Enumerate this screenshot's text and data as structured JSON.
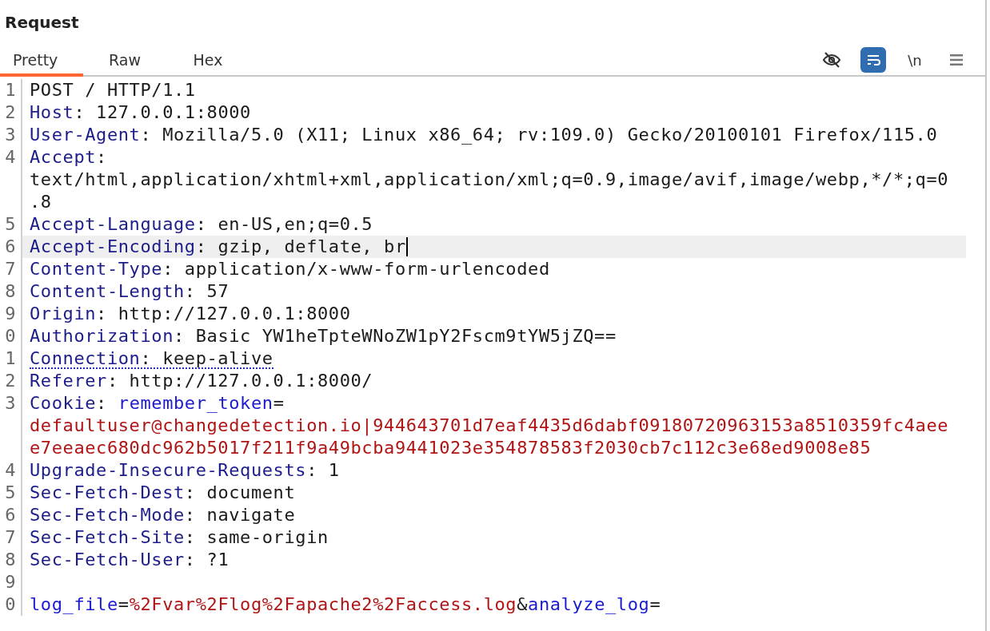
{
  "title": "Request",
  "tabs": [
    {
      "label": "Pretty",
      "selected": true
    },
    {
      "label": "Raw",
      "selected": false
    },
    {
      "label": "Hex",
      "selected": false
    }
  ],
  "toolbar": [
    {
      "kind": "hide",
      "selected": false
    },
    {
      "kind": "wrap",
      "selected": true
    },
    {
      "kind": "text",
      "label": "\\n",
      "selected": false
    },
    {
      "kind": "menu",
      "selected": false
    }
  ],
  "lines": [
    {
      "number": "1",
      "highlighted": false,
      "underlined": false,
      "rows": [
        [
          {
            "kind": "plain",
            "text": "POST / HTTP/1.1"
          }
        ]
      ]
    },
    {
      "number": "2",
      "highlighted": false,
      "underlined": false,
      "rows": [
        [
          {
            "kind": "name",
            "text": "Host"
          },
          {
            "kind": "plain",
            "text": ": 127.0.0.1:8000"
          }
        ]
      ]
    },
    {
      "number": "3",
      "highlighted": false,
      "underlined": false,
      "rows": [
        [
          {
            "kind": "name",
            "text": "User-Agent"
          },
          {
            "kind": "plain",
            "text": ": Mozilla/5.0 (X11; Linux x86_64; rv:109.0) Gecko/20100101 Firefox/115.0"
          }
        ]
      ]
    },
    {
      "number": "4",
      "highlighted": false,
      "underlined": false,
      "rows": [
        [
          {
            "kind": "name",
            "text": "Accept"
          },
          {
            "kind": "plain",
            "text": ":"
          }
        ],
        [
          {
            "kind": "plain",
            "text": "text/html,application/xhtml+xml,application/xml;q=0.9,image/avif,image/webp,*/*;q=0"
          }
        ],
        [
          {
            "kind": "plain",
            "text": ".8"
          }
        ]
      ]
    },
    {
      "number": "5",
      "highlighted": false,
      "underlined": false,
      "rows": [
        [
          {
            "kind": "name",
            "text": "Accept-Language"
          },
          {
            "kind": "plain",
            "text": ": en-US,en;q=0.5"
          }
        ]
      ]
    },
    {
      "number": "6",
      "highlighted": true,
      "underlined": false,
      "rows": [
        [
          {
            "kind": "name",
            "text": "Accept-Encoding"
          },
          {
            "kind": "plain",
            "text": ": gzip, deflate, br"
          }
        ]
      ]
    },
    {
      "number": "7",
      "highlighted": false,
      "underlined": false,
      "rows": [
        [
          {
            "kind": "name",
            "text": "Content-Type"
          },
          {
            "kind": "plain",
            "text": ": application/x-www-form-urlencoded"
          }
        ]
      ]
    },
    {
      "number": "8",
      "highlighted": false,
      "underlined": false,
      "rows": [
        [
          {
            "kind": "name",
            "text": "Content-Length"
          },
          {
            "kind": "plain",
            "text": ": 57"
          }
        ]
      ]
    },
    {
      "number": "9",
      "highlighted": false,
      "underlined": false,
      "rows": [
        [
          {
            "kind": "name",
            "text": "Origin"
          },
          {
            "kind": "plain",
            "text": ": http://127.0.0.1:8000"
          }
        ]
      ]
    },
    {
      "number": "0",
      "highlighted": false,
      "underlined": false,
      "rows": [
        [
          {
            "kind": "name",
            "text": "Authorization"
          },
          {
            "kind": "plain",
            "text": ": Basic YW1heTpteWNoZW1pY2Fscm9tYW5jZQ=="
          }
        ]
      ]
    },
    {
      "number": "1",
      "highlighted": false,
      "underlined": true,
      "rows": [
        [
          {
            "kind": "name",
            "text": "Connection"
          },
          {
            "kind": "plain",
            "text": ": keep-alive"
          }
        ]
      ]
    },
    {
      "number": "2",
      "highlighted": false,
      "underlined": false,
      "rows": [
        [
          {
            "kind": "name",
            "text": "Referer"
          },
          {
            "kind": "plain",
            "text": ": http://127.0.0.1:8000/"
          }
        ]
      ]
    },
    {
      "number": "3",
      "highlighted": false,
      "underlined": false,
      "rows": [
        [
          {
            "kind": "name",
            "text": "Cookie"
          },
          {
            "kind": "plain",
            "text": ": "
          },
          {
            "kind": "param_name",
            "text": "remember_token"
          },
          {
            "kind": "plain",
            "text": "="
          }
        ],
        [
          {
            "kind": "param_value",
            "text": "defaultuser@changedetection.io|944643701d7eaf4435d6dabf09180720963153a8510359fc4aee"
          }
        ],
        [
          {
            "kind": "param_value",
            "text": "e7eeaec680dc962b5017f211f9a49bcba9441023e354878583f2030cb7c112c3e68ed9008e85"
          }
        ]
      ]
    },
    {
      "number": "4",
      "highlighted": false,
      "underlined": false,
      "rows": [
        [
          {
            "kind": "name",
            "text": "Upgrade-Insecure-Requests"
          },
          {
            "kind": "plain",
            "text": ": 1"
          }
        ]
      ]
    },
    {
      "number": "5",
      "highlighted": false,
      "underlined": false,
      "rows": [
        [
          {
            "kind": "name",
            "text": "Sec-Fetch-Dest"
          },
          {
            "kind": "plain",
            "text": ": document"
          }
        ]
      ]
    },
    {
      "number": "6",
      "highlighted": false,
      "underlined": false,
      "rows": [
        [
          {
            "kind": "name",
            "text": "Sec-Fetch-Mode"
          },
          {
            "kind": "plain",
            "text": ": navigate"
          }
        ]
      ]
    },
    {
      "number": "7",
      "highlighted": false,
      "underlined": false,
      "rows": [
        [
          {
            "kind": "name",
            "text": "Sec-Fetch-Site"
          },
          {
            "kind": "plain",
            "text": ": same-origin"
          }
        ]
      ]
    },
    {
      "number": "8",
      "highlighted": false,
      "underlined": false,
      "rows": [
        [
          {
            "kind": "name",
            "text": "Sec-Fetch-User"
          },
          {
            "kind": "plain",
            "text": ": ?1"
          }
        ]
      ]
    },
    {
      "number": "9",
      "highlighted": false,
      "underlined": false,
      "rows": [
        []
      ]
    },
    {
      "number": "0",
      "highlighted": false,
      "underlined": false,
      "rows": [
        [
          {
            "kind": "param_name",
            "text": "log_file"
          },
          {
            "kind": "plain",
            "text": "="
          },
          {
            "kind": "param_value",
            "text": "%2Fvar%2Flog%2Fapache2%2Faccess.log"
          },
          {
            "kind": "plain",
            "text": "&"
          },
          {
            "kind": "param_name",
            "text": "analyze_log"
          },
          {
            "kind": "plain",
            "text": "="
          }
        ]
      ]
    }
  ]
}
